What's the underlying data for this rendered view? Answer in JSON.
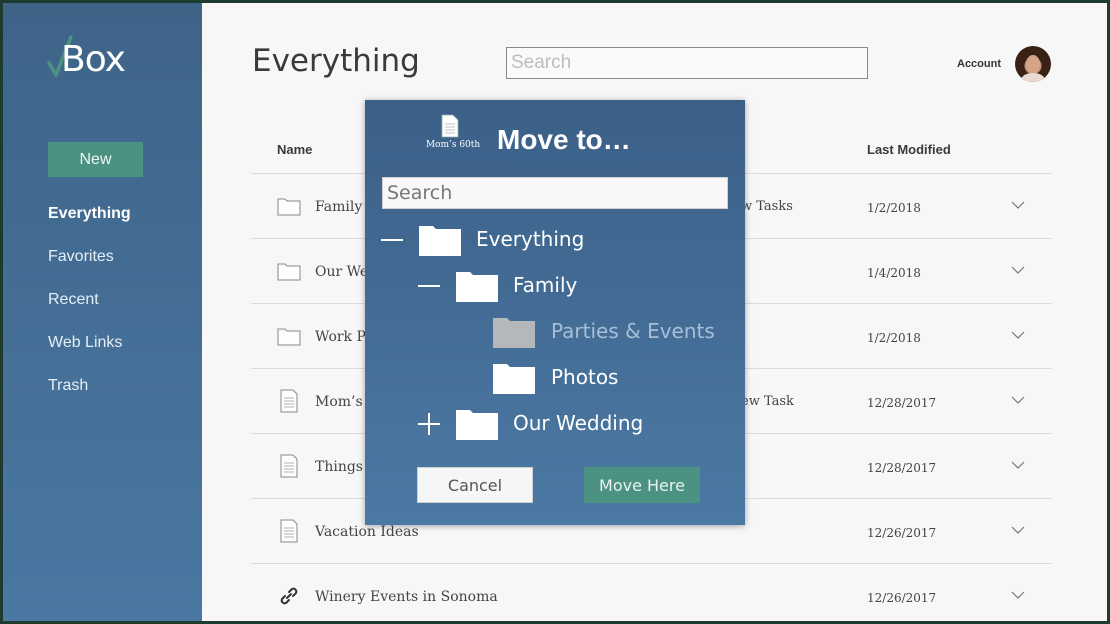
{
  "app": {
    "logo_text": "Box"
  },
  "sidebar": {
    "new_label": "New",
    "items": [
      {
        "label": "Everything",
        "active": true
      },
      {
        "label": "Favorites"
      },
      {
        "label": "Recent"
      },
      {
        "label": "Web Links"
      },
      {
        "label": "Trash"
      }
    ]
  },
  "header": {
    "title": "Everything",
    "search_placeholder": "Search",
    "account_label": "Account"
  },
  "table": {
    "columns": {
      "name": "Name",
      "last_modified": "Last Modified"
    },
    "rows": [
      {
        "icon": "folder-icon",
        "name": "Family",
        "extra": "w Tasks",
        "date": "1/2/2018"
      },
      {
        "icon": "folder-icon",
        "name": "Our We",
        "extra": "",
        "date": "1/4/2018"
      },
      {
        "icon": "folder-icon",
        "name": "Work P",
        "extra": "",
        "date": "1/2/2018"
      },
      {
        "icon": "document-icon",
        "name": "Mom’s",
        "extra": "ew Task",
        "date": "12/28/2017"
      },
      {
        "icon": "document-icon",
        "name": "Things",
        "extra": "",
        "date": "12/28/2017"
      },
      {
        "icon": "document-icon",
        "name": "Vacation Ideas",
        "extra": "",
        "date": "12/26/2017"
      },
      {
        "icon": "link-icon",
        "name": "Winery Events in Sonoma",
        "extra": "",
        "date": "12/26/2017"
      }
    ]
  },
  "modal": {
    "file_label": "Mom’s 60th",
    "title": "Move to…",
    "search_placeholder": "Search",
    "tree": [
      {
        "toggle": "collapse",
        "label": "Everything",
        "depth": 0
      },
      {
        "toggle": "collapse",
        "label": "Family",
        "depth": 1
      },
      {
        "toggle": "none",
        "label": "Parties & Events",
        "depth": 2,
        "disabled": true
      },
      {
        "toggle": "none",
        "label": "Photos",
        "depth": 2
      },
      {
        "toggle": "expand",
        "label": "Our Wedding",
        "depth": 1
      }
    ],
    "cancel_label": "Cancel",
    "move_label": "Move Here"
  },
  "colors": {
    "sidebar": "#4a78a2",
    "accent_green": "#4c9283",
    "modal": "#426c95",
    "background": "#f7f7f7"
  }
}
